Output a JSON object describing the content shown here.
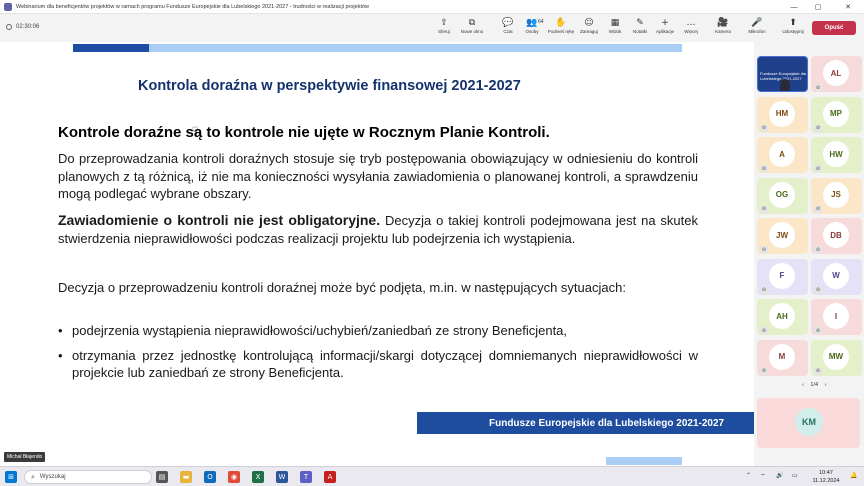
{
  "window": {
    "title": "Webinarium dla beneficjentów projektów w ramach programu Fundusze Europejskie dla Lubelskiego 2021-2027 - trudności w realizacji projektów",
    "controls": [
      "—",
      "▢",
      "✕"
    ]
  },
  "meeting": {
    "timer": "02:30:06",
    "toolbar": [
      {
        "icon": "share-icon",
        "glyph": "⇪",
        "label": "Sferuj"
      },
      {
        "icon": "new-window-icon",
        "glyph": "⧉",
        "label": "Nowe okno"
      },
      {
        "icon": "chat-icon",
        "glyph": "💬",
        "label": "Czat"
      },
      {
        "icon": "people-icon",
        "glyph": "👥",
        "label": "Osoby",
        "count": "64"
      },
      {
        "icon": "raise-hand-icon",
        "glyph": "✋",
        "label": "Podnieś rękę"
      },
      {
        "icon": "react-icon",
        "glyph": "☺",
        "label": "Zareaguj"
      },
      {
        "icon": "view-icon",
        "glyph": "▦",
        "label": "Widok"
      },
      {
        "icon": "notes-icon",
        "glyph": "✎",
        "label": "Notatki"
      },
      {
        "icon": "apps-icon",
        "glyph": "+",
        "label": "Aplikacje"
      },
      {
        "icon": "more-icon",
        "glyph": "…",
        "label": "Więcej"
      },
      {
        "icon": "camera-icon",
        "glyph": "🎥",
        "label": "Kamera"
      },
      {
        "icon": "mic-icon",
        "glyph": "🎤",
        "label": "Mikrofon"
      },
      {
        "icon": "share-screen-icon",
        "glyph": "⬆",
        "label": "Udostępnij"
      }
    ],
    "leave_label": "Opuść",
    "presenter": "Michał Błajendo"
  },
  "slide": {
    "title": "Kontrola doraźna w perspektywie finansowej 2021-2027",
    "heading": "Kontrole doraźne są to kontrole nie ujęte w Rocznym Planie Kontroli.",
    "para1": "Do przeprowadzania kontroli doraźnych stosuje się tryb postępowania obowiązujący w odniesieniu do kontroli planowych z tą różnicą, iż nie ma konieczności wysyłania zawiadomienia o planowanej kontroli, a sprawdzeniu mogą podlegać wybrane obszary.",
    "para2_bold": "Zawiadomienie o kontroli nie jest obligatoryjne.",
    "para2_rest": " Decyzja o takiej kontroli podejmowana jest na skutek stwierdzenia nieprawidłowości podczas realizacji projektu lub podejrzenia ich wystąpienia.",
    "para3": "Decyzja o przeprowadzeniu kontroli doraźnej może być podjęta, m.in. w następujących sytuacjach:",
    "bullets": [
      "podejrzenia wystąpienia nieprawidłowości/uchybień/zaniedbań ze strony Beneficjenta,",
      "otrzymania przez jednostkę kontrolującą informacji/skargi dotyczącej domniemanych nieprawidłowości w projekcie lub zaniedbań ze strony Beneficjenta."
    ],
    "bullet_glyph": "•",
    "footer": "Fundusze Europejskie dla Lubelskiego 2021-2027"
  },
  "participants": {
    "video_tile_text": "Fundusze Europejskie dla Lubelskiego 2021-2027",
    "tiles": [
      {
        "initials": "AL",
        "bg": "#f7dada",
        "fg": "#8a3b3b"
      },
      {
        "initials": "HM",
        "bg": "#fbe6c7",
        "fg": "#7a4e12"
      },
      {
        "initials": "MP",
        "bg": "#e3f0c9",
        "fg": "#4a6a1a"
      },
      {
        "initials": "A",
        "bg": "#fbe6c7",
        "fg": "#7a4e12"
      },
      {
        "initials": "HW",
        "bg": "#e3f0c9",
        "fg": "#4a6a1a"
      },
      {
        "initials": "OG",
        "bg": "#e3f0c9",
        "fg": "#4a6a1a"
      },
      {
        "initials": "JS",
        "bg": "#fbe6c7",
        "fg": "#7a4e12"
      },
      {
        "initials": "JW",
        "bg": "#fbe6c7",
        "fg": "#7a4e12"
      },
      {
        "initials": "DB",
        "bg": "#f7dada",
        "fg": "#8a3b3b"
      },
      {
        "initials": "F",
        "bg": "#e4e2f6",
        "fg": "#4b4690"
      },
      {
        "initials": "W",
        "bg": "#e4e2f6",
        "fg": "#4b4690"
      },
      {
        "initials": "AH",
        "bg": "#e3f0c9",
        "fg": "#4a6a1a"
      },
      {
        "initials": "I",
        "bg": "#f7dada",
        "fg": "#8a3b3b"
      },
      {
        "initials": "M",
        "bg": "#f7dada",
        "fg": "#8a3b3b"
      },
      {
        "initials": "MW",
        "bg": "#e3f0c9",
        "fg": "#4a6a1a"
      }
    ],
    "pager": {
      "prev": "‹",
      "text": "1/4",
      "next": "›"
    },
    "featured": {
      "initials": "KM"
    }
  },
  "taskbar": {
    "search_placeholder": "Wyszukaj",
    "time": "10:47",
    "date": "11.12.2024",
    "apps": [
      {
        "icon": "task-view-icon",
        "glyph": "▤",
        "color": "#555"
      },
      {
        "icon": "file-explorer-icon",
        "glyph": "▬",
        "color": "#e8b339"
      },
      {
        "icon": "outlook-icon",
        "glyph": "O",
        "color": "#0f6cbd"
      },
      {
        "icon": "chrome-icon",
        "glyph": "◉",
        "color": "#dd4b39"
      },
      {
        "icon": "excel-icon",
        "glyph": "X",
        "color": "#1e7145"
      },
      {
        "icon": "word-icon",
        "glyph": "W",
        "color": "#2b579a"
      },
      {
        "icon": "teams-icon",
        "glyph": "T",
        "color": "#5b5fc7"
      },
      {
        "icon": "acrobat-icon",
        "glyph": "A",
        "color": "#c4201f"
      }
    ]
  },
  "colors": {
    "slide_title": "#14336e",
    "band_dark": "#1e4da0",
    "band_light": "#a9cdf4",
    "leave_button": "#c4314b",
    "active_tile_border": "#4a6fd1"
  }
}
